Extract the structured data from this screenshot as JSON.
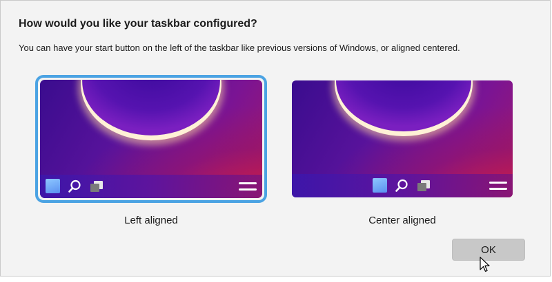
{
  "dialog": {
    "title": "How would you like your taskbar configured?",
    "subtitle": "You can have your start button on the left of the taskbar like previous versions of Windows, or aligned centered."
  },
  "options": [
    {
      "label": "Left aligned",
      "selected": true,
      "alignment": "left",
      "icons": [
        "start-icon",
        "search-icon",
        "task-view-icon",
        "menu-icon"
      ]
    },
    {
      "label": "Center aligned",
      "selected": false,
      "alignment": "center",
      "icons": [
        "start-icon",
        "search-icon",
        "task-view-icon",
        "menu-icon"
      ]
    }
  ],
  "buttons": {
    "ok_label": "OK"
  },
  "colors": {
    "selection_border": "#4ba3e3",
    "dialog_background": "#f3f3f3",
    "button_background": "#c8c8c8",
    "start_icon": "#6fa8f5"
  }
}
